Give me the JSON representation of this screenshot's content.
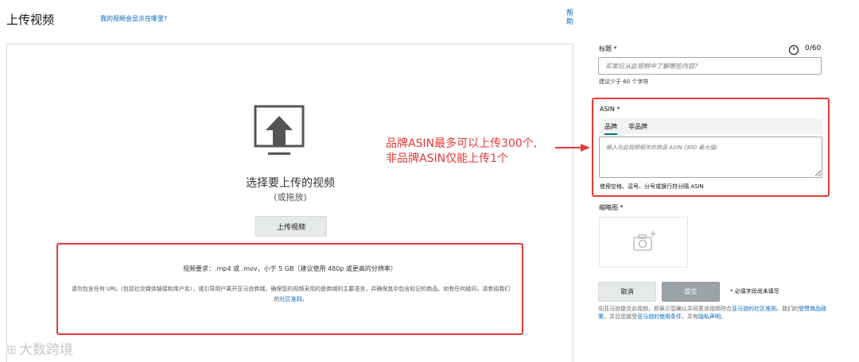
{
  "header": {
    "title": "上传视频",
    "where_link": "我的视频会显示在哪里?",
    "help_link": "帮助"
  },
  "upload": {
    "heading": "选择要上传的视频",
    "subheading": "(或拖放)",
    "button_label": "上传视频",
    "requirements_title": "视频要求：.mp4 或 .mov，小于 5 GB（建议使用 480p 或更高的分辨率）",
    "requirements_desc": "请勿包含任何 URL（包括社交媒体链接和用户名），或引导用户离开亚马逊商城。确保您的视频采用的是商城的主要语言，并确保其中包含标记的商品。如有任何疑问，请参阅我们的",
    "community_link": "社区准则",
    "requirements_end": "。"
  },
  "annotation": {
    "line1": "品牌ASIN最多可以上传300个,",
    "line2": "非品牌ASIN仅能上传1个",
    "color": "#e53935"
  },
  "form": {
    "title_label": "标题 *",
    "title_count": "0/60",
    "title_placeholder": "买家应从此视频中了解哪些内容?",
    "title_hint": "建议少于 60 个字符",
    "asin_label": "ASIN *",
    "asin_tabs": [
      "品牌",
      "非品牌"
    ],
    "asin_placeholder": "输入与此视频相关的商品 ASIN (300 最大值)",
    "asin_hint": "使用空格、逗号、分号或换行符分隔 ASIN",
    "thumbnail_label": "缩略图 *",
    "cancel_label": "取消",
    "submit_label": "提交",
    "required_note": "* 必填字段尚未填写",
    "legal_prefix": "向亚马逊提交此视频，即表示您确认并同意该视频符合",
    "legal_link1": "亚马逊的社区准则",
    "legal_mid1": "。我们的",
    "legal_link2": "受赞商品政策",
    "legal_mid2": "，并且您接受",
    "legal_link3": "亚马逊的使用条件",
    "legal_mid3": "，并有",
    "legal_link4": "隐私声明",
    "legal_end": "。"
  },
  "watermark": {
    "logo": "ꕥ",
    "text": "大数跨境"
  },
  "colors": {
    "link": "#0066c0",
    "highlight_border": "#e53935",
    "tab_accent": "#007185"
  }
}
